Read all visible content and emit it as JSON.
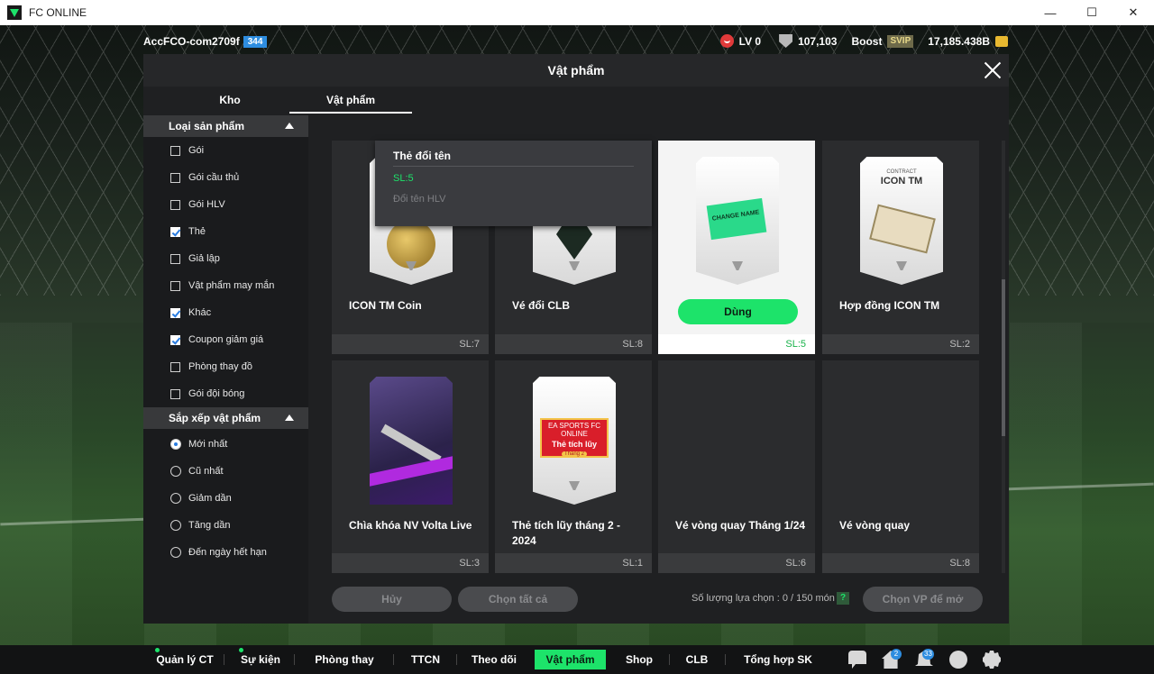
{
  "window": {
    "title": "FC ONLINE",
    "minimize": "—",
    "maximize": "☐",
    "close": "✕"
  },
  "topbar": {
    "account_name": "AccFCO-com2709f",
    "account_badge": "344",
    "level": "LV 0",
    "points": "107,103",
    "boost_label": "Boost",
    "vip_label": "SVIP",
    "coins": "17,185.438B"
  },
  "panel": {
    "title": "Vật phẩm",
    "tabs": [
      "Kho",
      "Vật phẩm"
    ],
    "active_tab": "Vật phẩm"
  },
  "filters": {
    "product_type": {
      "heading": "Loại sản phẩm",
      "options": [
        {
          "label": "Gói",
          "checked": false
        },
        {
          "label": "Gói cầu thủ",
          "checked": false
        },
        {
          "label": "Gói HLV",
          "checked": false
        },
        {
          "label": "Thẻ",
          "checked": true
        },
        {
          "label": "Giả lập",
          "checked": false
        },
        {
          "label": "Vật phẩm may mắn",
          "checked": false
        },
        {
          "label": "Khác",
          "checked": true
        },
        {
          "label": "Coupon giảm giá",
          "checked": true
        },
        {
          "label": "Phòng thay đồ",
          "checked": false
        },
        {
          "label": "Gói đội bóng",
          "checked": false
        }
      ]
    },
    "sort": {
      "heading": "Sắp xếp vật phẩm",
      "options": [
        {
          "label": "Mới nhất",
          "selected": true
        },
        {
          "label": "Cũ nhất",
          "selected": false
        },
        {
          "label": "Giảm dần",
          "selected": false
        },
        {
          "label": "Tăng dần",
          "selected": false
        },
        {
          "label": "Đến ngày hết hạn",
          "selected": false
        }
      ]
    }
  },
  "items": [
    {
      "name": "ICON TM Coin",
      "qty": "SL:7",
      "art": "coin"
    },
    {
      "name": "Vé đổi CLB",
      "qty": "SL:8",
      "art": "crest"
    },
    {
      "name": "",
      "qty": "SL:5",
      "art": "change-name",
      "art_text": "CHANGE NAME",
      "selected": true,
      "action": "Dùng"
    },
    {
      "name": "Hợp đồng ICON TM",
      "qty": "SL:2",
      "art": "contract",
      "art_small": "CONTRACT",
      "art_title": "ICON TM"
    },
    {
      "name": "Chìa khóa NV Volta Live",
      "qty": "SL:3",
      "art": "volta"
    },
    {
      "name": "Thẻ tích lũy tháng 2 - 2024",
      "qty": "SL:1",
      "art": "voucher",
      "art_small": "EA SPORTS FC ONLINE",
      "art_title": "Thẻ tích lũy",
      "art_pill": "Tháng 2"
    },
    {
      "name": "Vé vòng quay Tháng 1/24",
      "qty": "SL:6",
      "art": "none"
    },
    {
      "name": "Vé vòng quay",
      "qty": "SL:8",
      "art": "none"
    }
  ],
  "tooltip": {
    "title": "Thẻ đổi tên",
    "qty": "SL:5",
    "desc": "Đổi tên HLV"
  },
  "actions": {
    "cancel": "Hủy",
    "select_all": "Chọn tất cả",
    "selection_count": "Số lượng lựa chọn : 0 / 150 món",
    "help": "?",
    "open_selected": "Chọn VP để mở"
  },
  "bottomnav": {
    "items": [
      "Quản lý CT",
      "Sự kiện",
      "Phòng thay đồ",
      "TTCN",
      "Theo dõi",
      "Vật phẩm",
      "Shop",
      "CLB",
      "Tổng hợp SK mới"
    ],
    "active": "Vật phẩm",
    "home_badge": "2",
    "bell_badge": "33"
  },
  "colors": {
    "accent": "#1de36a",
    "panel": "#1f2022",
    "card": "#2b2c2e"
  }
}
